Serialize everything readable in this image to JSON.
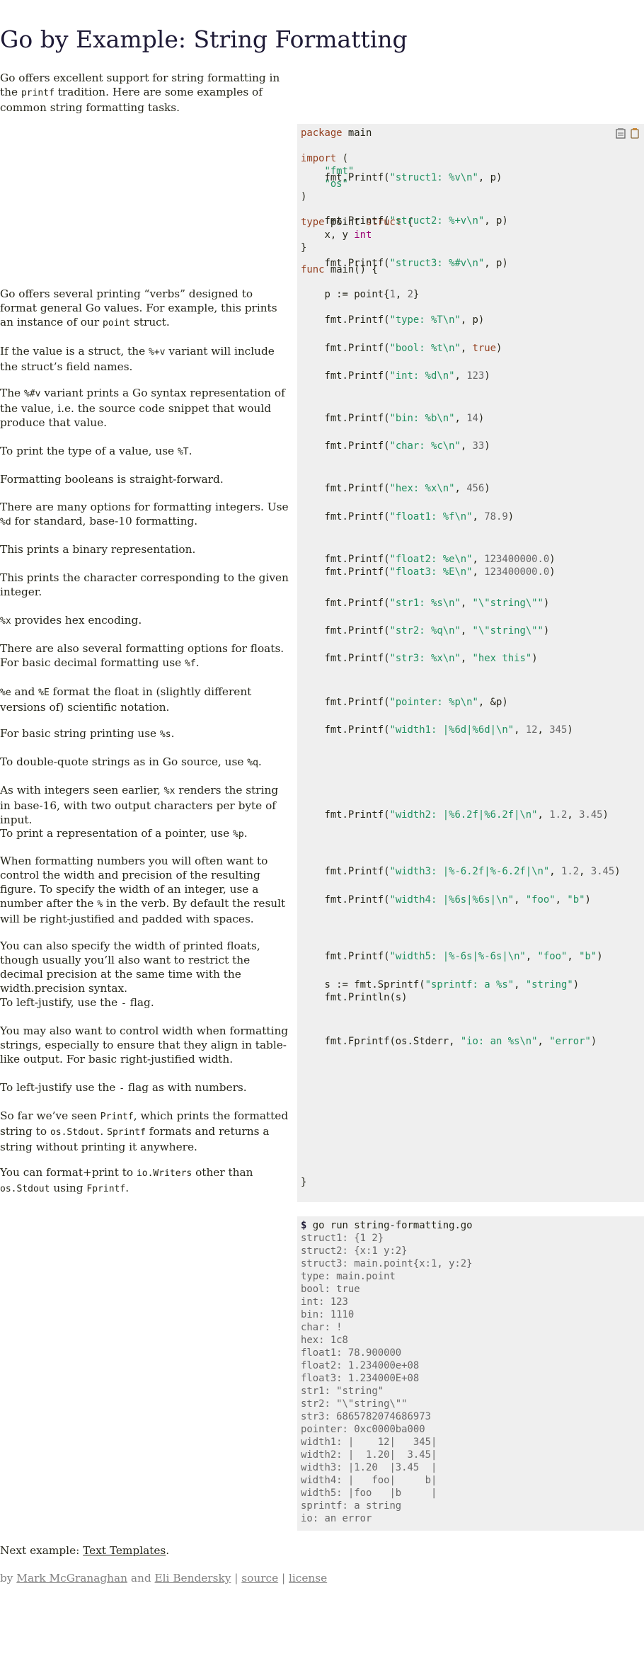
{
  "page": {
    "title": "Go by Example: String Formatting"
  },
  "intro": {
    "t1": "Go offers excellent support for string formatting in the",
    "c1": "printf",
    "t2": " tradition. Here are some examples of common string formatting tasks."
  },
  "icons": {
    "left": "run-icon",
    "right": "copy-icon"
  },
  "code": {
    "pkg": {
      "kw": "package",
      "name": "main"
    },
    "import_kw": "import",
    "import_open": "(",
    "import_fmt": "\"fmt\"",
    "import_os": "\"os\"",
    "import_close": ")",
    "type_kw": "type",
    "type_name": "point",
    "struct_kw": "struct",
    "struct_open": "{",
    "field": "x, y",
    "field_type": "int",
    "struct_close": "}",
    "func_kw": "func",
    "func_sig": "main() {",
    "p_decl_a": "p := point{",
    "p_decl_n1": "1",
    "p_decl_b": ", ",
    "p_decl_n2": "2",
    "p_decl_c": "}",
    "final_close": "}",
    "call": "fmt.Printf(",
    "call_sprintf": "s := fmt.Sprintf(",
    "call_println": "fmt.Println(s)",
    "call_fprintf": "fmt.Fprintf(os.Stderr, "
  },
  "sections": [
    {
      "doc": [
        "Go offers several printing “verbs” designed to format general Go values. For example, this prints an instance of our ",
        {
          "c": "point"
        },
        " struct."
      ],
      "fmt": "\"struct1: %v\\n\"",
      "args": ", p)"
    },
    {
      "doc": [
        "If the value is a struct, the ",
        {
          "c": "%+v"
        },
        " variant will include the struct’s field names."
      ],
      "fmt": "\"struct2: %+v\\n\"",
      "args": ", p)"
    },
    {
      "doc": [
        "The ",
        {
          "c": "%#v"
        },
        " variant prints a Go syntax representation of the value, i.e. the source code snippet that would produce that value."
      ],
      "fmt": "\"struct3: %#v\\n\"",
      "args": ", p)"
    },
    {
      "doc": [
        "To print the type of a value, use ",
        {
          "c": "%T"
        },
        "."
      ],
      "fmt": "\"type: %T\\n\"",
      "args": ", p)"
    },
    {
      "doc": [
        "Formatting booleans is straight-forward."
      ],
      "fmt": "\"bool: %t\\n\"",
      "args": ", true)"
    },
    {
      "doc": [
        "There are many options for formatting integers. Use ",
        {
          "c": "%d"
        },
        " for standard, base-10 formatting."
      ],
      "fmt": "\"int: %d\\n\"",
      "args": ", 123)"
    },
    {
      "doc": [
        "This prints a binary representation."
      ],
      "fmt": "\"bin: %b\\n\"",
      "args": ", 14)"
    },
    {
      "doc": [
        "This prints the character corresponding to the given integer."
      ],
      "fmt": "\"char: %c\\n\"",
      "args": ", 33)"
    },
    {
      "doc": [
        {
          "c": "%x"
        },
        " provides hex encoding."
      ],
      "fmt": "\"hex: %x\\n\"",
      "args": ", 456)"
    },
    {
      "doc": [
        "There are also several formatting options for floats. For basic decimal formatting use ",
        {
          "c": "%f"
        },
        "."
      ],
      "fmt": "\"float1: %f\\n\"",
      "args": ", 78.9)"
    },
    {
      "doc": [
        {
          "c": "%e"
        },
        " and ",
        {
          "c": "%E"
        },
        " format the float in (slightly different versions of) scientific notation."
      ],
      "fmt": "\"float2: %e\\n\"",
      "args": ", 123400000.0)",
      "fmt2": "\"float3: %E\\n\"",
      "args2": ", 123400000.0)"
    },
    {
      "doc": [
        "For basic string printing use ",
        {
          "c": "%s"
        },
        "."
      ],
      "fmt": "\"str1: %s\\n\"",
      "args_pre": ", ",
      "argstr": "\"\\\"string\\\"\"",
      "args": ")"
    },
    {
      "doc": [
        "To double-quote strings as in Go source, use ",
        {
          "c": "%q"
        },
        "."
      ],
      "fmt": "\"str2: %q\\n\"",
      "args_pre": ", ",
      "argstr": "\"\\\"string\\\"\"",
      "args": ")"
    },
    {
      "doc": [
        "As with integers seen earlier, ",
        {
          "c": "%x"
        },
        " renders the string in base-16, with two output characters per byte of input."
      ],
      "fmt": "\"str3: %x\\n\"",
      "args_pre": ", ",
      "argstr": "\"hex this\"",
      "args": ")"
    },
    {
      "doc": [
        "To print a representation of a pointer, use ",
        {
          "c": "%p"
        },
        "."
      ],
      "fmt": "\"pointer: %p\\n\"",
      "args": ", &p)"
    },
    {
      "doc": [
        "When formatting numbers you will often want to control the width and precision of the resulting figure. To specify the width of an integer, use a number after the ",
        {
          "c": "%"
        },
        " in the verb. By default the result will be right-justified and padded with spaces."
      ],
      "fmt": "\"width1: |%6d|%6d|\\n\"",
      "args": ", 12, 345)"
    },
    {
      "doc": [
        "You can also specify the width of printed floats, though usually you’ll also want to restrict the decimal precision at the same time with the width.precision syntax."
      ],
      "fmt": "\"width2: |%6.2f|%6.2f|\\n\"",
      "args": ", 1.2, 3.45)"
    },
    {
      "doc": [
        "To left-justify, use the ",
        {
          "c": "-"
        },
        " flag."
      ],
      "fmt": "\"width3: |%-6.2f|%-6.2f|\\n\"",
      "args": ", 1.2, 3.45)"
    },
    {
      "doc": [
        "You may also want to control width when formatting strings, especially to ensure that they align in table-like output. For basic right-justified width."
      ],
      "fmt": "\"width4: |%6s|%6s|\\n\"",
      "args_pre": ", ",
      "argstr": "\"foo\"",
      "args_mid": ", ",
      "argstr2": "\"b\"",
      "args": ")"
    },
    {
      "doc": [
        "To left-justify use the ",
        {
          "c": "-"
        },
        " flag as with numbers."
      ],
      "fmt": "\"width5: |%-6s|%-6s|\\n\"",
      "args_pre": ", ",
      "argstr": "\"foo\"",
      "args_mid": ", ",
      "argstr2": "\"b\"",
      "args": ")"
    },
    {
      "doc": [
        "So far we’ve seen ",
        {
          "c": "Printf"
        },
        ", which prints the formatted string to ",
        {
          "c": "os.Stdout"
        },
        ". ",
        {
          "c": "Sprintf"
        },
        " formats and returns a string without printing it anywhere."
      ],
      "fmt": "\"sprintf: a %s\"",
      "args_pre": ", ",
      "argstr": "\"string\"",
      "args": ")"
    },
    {
      "doc": [
        "You can format+print to ",
        {
          "c": "io.Writers"
        },
        " other than ",
        {
          "c": "os.Stdout"
        },
        " using ",
        {
          "c": "Fprintf"
        },
        "."
      ],
      "fmt": "\"io: an %s\\n\"",
      "args_pre": ", ",
      "argstr": "\"error\"",
      "args": ")"
    }
  ],
  "output": {
    "prompt": "$",
    "command": " go run string-formatting.go",
    "lines": [
      "struct1: {1 2}",
      "struct2: {x:1 y:2}",
      "struct3: main.point{x:1, y:2}",
      "type: main.point",
      "bool: true",
      "int: 123",
      "bin: 1110",
      "char: !",
      "hex: 1c8",
      "float1: 78.900000",
      "float2: 1.234000e+08",
      "float3: 1.234000E+08",
      "str1: \"string\"",
      "str2: \"\\\"string\\\"\"",
      "str3: 6865782074686973",
      "pointer: 0xc0000ba000",
      "width1: |    12|   345|",
      "width2: |  1.20|  3.45|",
      "width3: |1.20  |3.45  |",
      "width4: |   foo|     b|",
      "width5: |foo   |b     |",
      "sprintf: a string",
      "io: an error"
    ]
  },
  "footer": {
    "next_prefix": "Next example: ",
    "next_link": "Text Templates",
    "next_suffix": ".",
    "by": "by ",
    "author1": "Mark McGranaghan",
    "and": " and ",
    "author2": "Eli Bendersky",
    "sep1": " | ",
    "source": "source",
    "sep2": " | ",
    "license": "license"
  }
}
